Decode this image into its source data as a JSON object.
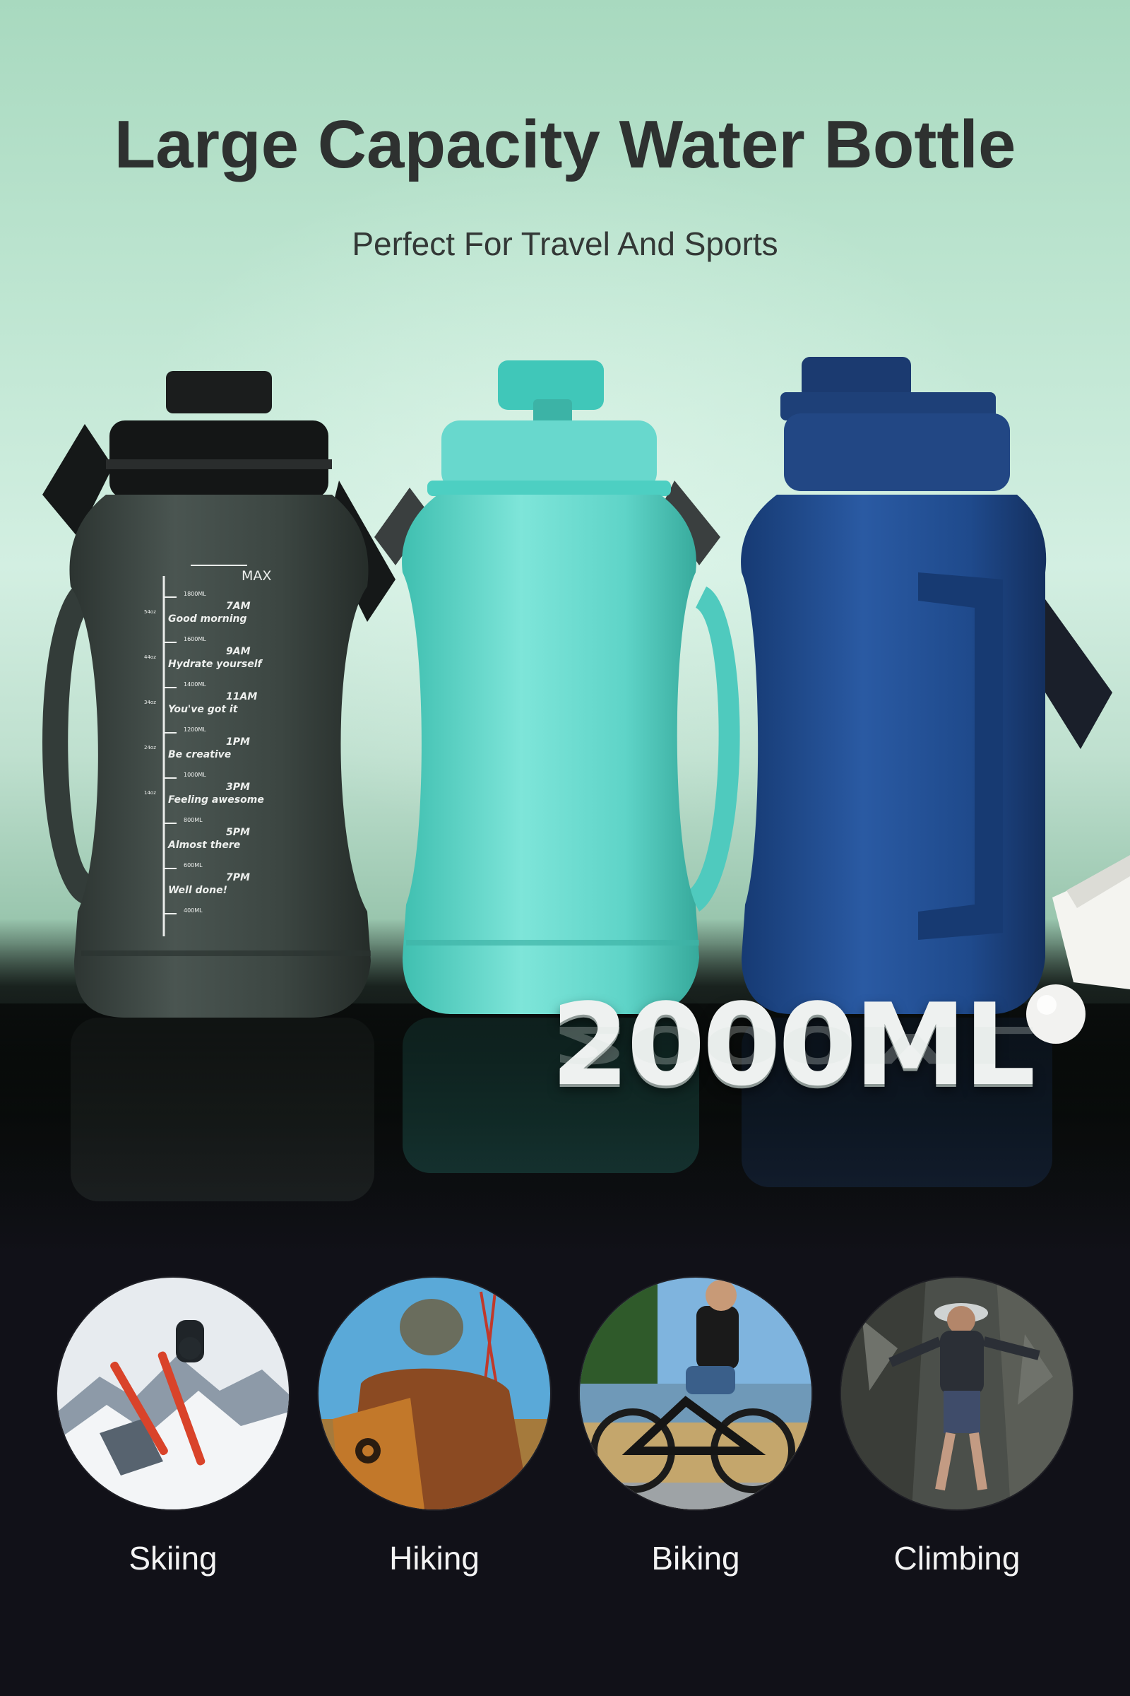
{
  "headline": "Large Capacity Water Bottle",
  "subheadline": "Perfect For Travel And Sports",
  "capacity_badge": "2000ML",
  "bottles": [
    {
      "color_name": "dark grey",
      "color": "#3c4642",
      "marker": {
        "max_label": "MAX",
        "ml_marks": [
          "1800ML",
          "1600ML",
          "1400ML",
          "1200ML",
          "1000ML",
          "800ML",
          "600ML",
          "400ML"
        ],
        "oz_marks": [
          "54oz",
          "44oz",
          "34oz",
          "24oz",
          "14oz"
        ],
        "times": [
          {
            "time": "7AM",
            "message": "Good morning"
          },
          {
            "time": "9AM",
            "message": "Hydrate yourself"
          },
          {
            "time": "11AM",
            "message": "You've got it"
          },
          {
            "time": "1PM",
            "message": "Be creative"
          },
          {
            "time": "3PM",
            "message": "Feeling awesome"
          },
          {
            "time": "5PM",
            "message": "Almost there"
          },
          {
            "time": "7PM",
            "message": "Well done!"
          }
        ]
      }
    },
    {
      "color_name": "aqua",
      "color": "#5fd4c8"
    },
    {
      "color_name": "navy blue",
      "color": "#1f4a8c"
    }
  ],
  "activities": [
    {
      "label": "Skiing",
      "icon": "skier-photo"
    },
    {
      "label": "Hiking",
      "icon": "hiker-photo"
    },
    {
      "label": "Biking",
      "icon": "cyclist-photo"
    },
    {
      "label": "Climbing",
      "icon": "climber-photo"
    }
  ]
}
